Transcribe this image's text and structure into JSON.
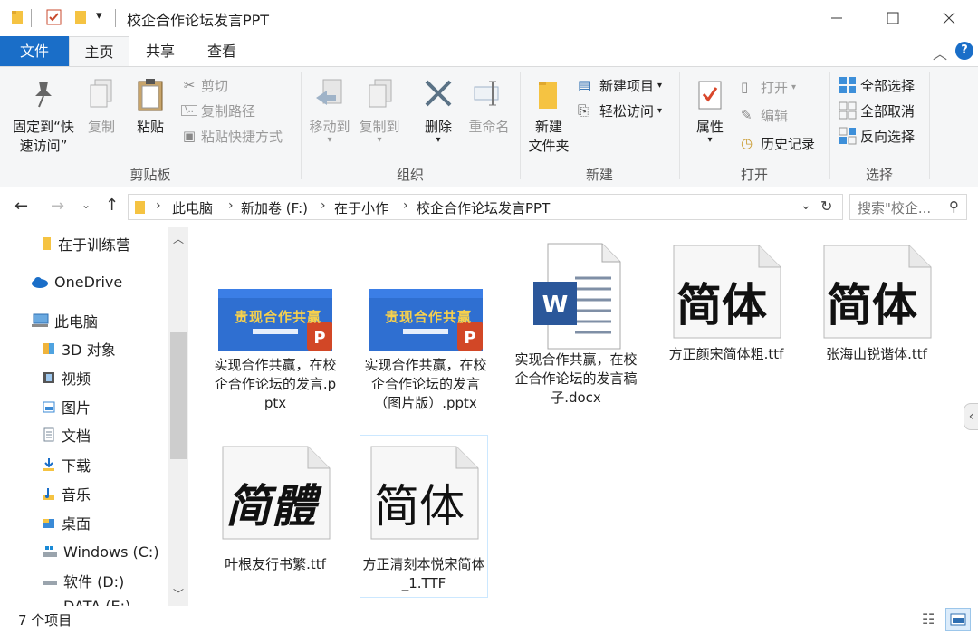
{
  "window": {
    "title": "校企合作论坛发言PPT"
  },
  "ribbon_tabs": {
    "file": "文件",
    "home": "主页",
    "share": "共享",
    "view": "查看"
  },
  "ribbon": {
    "clipboard": {
      "pin": "固定到“快",
      "pin2": "速访问”",
      "copy": "复制",
      "paste": "粘贴",
      "cut": "剪切",
      "copy_path": "复制路径",
      "paste_shortcut": "粘贴快捷方式",
      "group_label": "剪贴板"
    },
    "organize": {
      "move_to": "移动到",
      "copy_to": "复制到",
      "delete": "删除",
      "rename": "重命名",
      "group_label": "组织"
    },
    "new": {
      "new_folder": "新建",
      "new_folder2": "文件夹",
      "new_item": "新建项目",
      "easy_access": "轻松访问",
      "group_label": "新建"
    },
    "open": {
      "properties": "属性",
      "open": "打开",
      "edit": "编辑",
      "history": "历史记录",
      "group_label": "打开"
    },
    "select": {
      "select_all": "全部选择",
      "select_none": "全部取消",
      "invert": "反向选择",
      "group_label": "选择"
    }
  },
  "address": {
    "crumbs": [
      "此电脑",
      "新加卷 (F:)",
      "在于小作",
      "校企合作论坛发言PPT"
    ],
    "search_placeholder": "搜索\"校企..."
  },
  "nav": {
    "items": [
      "在于训练营",
      "OneDrive",
      "此电脑",
      "3D 对象",
      "视频",
      "图片",
      "文档",
      "下载",
      "音乐",
      "桌面",
      "Windows (C:)",
      "软件 (D:)",
      "DATA (E:)"
    ]
  },
  "files": [
    {
      "name": "实现合作共赢，在校企合作论坛的发言.pptx",
      "type": "pptx",
      "thumb_title": "贵现合作共赢"
    },
    {
      "name": "实现合作共赢，在校企合作论坛的发言（图片版）.pptx",
      "type": "pptx",
      "thumb_title": "贵现合作共赢"
    },
    {
      "name": "实现合作共赢，在校企合作论坛的发言稿子.docx",
      "type": "docx"
    },
    {
      "name": "方正颜宋简体粗.ttf",
      "type": "ttf",
      "sample": "简体"
    },
    {
      "name": "张海山锐谐体.ttf",
      "type": "ttf",
      "sample": "简体"
    },
    {
      "name": "叶根友行书繁.ttf",
      "type": "ttf",
      "sample": "简體"
    },
    {
      "name": "方正清刻本悦宋简体_1.TTF",
      "type": "ttf",
      "sample": "简体"
    }
  ],
  "status": {
    "count": "7 个项目"
  },
  "colors": {
    "accent": "#1a6ec8",
    "ppt_blue": "#2f6fd1",
    "ppt_orange": "#d24726",
    "word_blue": "#2b579a",
    "selection": "#cce8ff"
  }
}
